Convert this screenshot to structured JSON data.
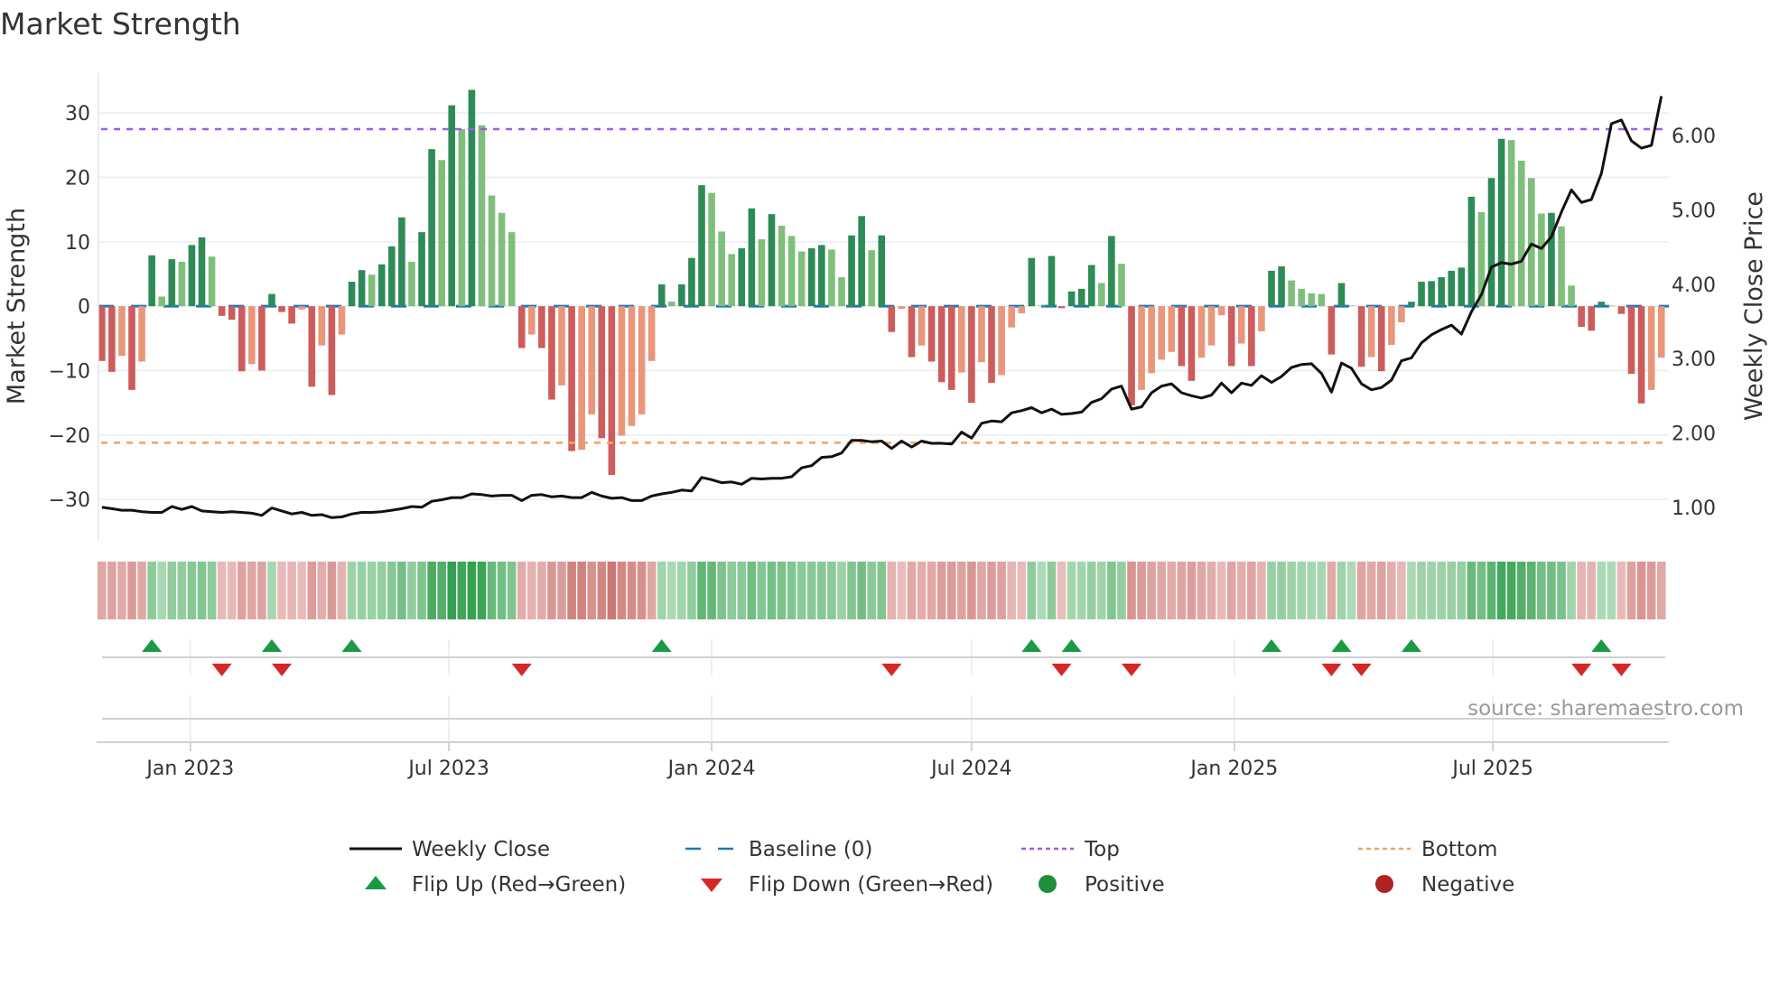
{
  "title": "Market Strength",
  "source": "source: sharemaestro.com",
  "colors": {
    "bar_pos_strong": "#2e8b57",
    "bar_pos_weak": "#7fbf7b",
    "bar_neg_strong": "#cd5c5c",
    "bar_neg_weak": "#e9967a",
    "baseline": "#1f77b4",
    "top": "#9b5de5",
    "bottom": "#f4a261",
    "close": "#111111",
    "flip_up": "#1a9a45",
    "flip_down": "#d62728",
    "positive": "#1e8f3a",
    "negative": "#b22222"
  },
  "legend": [
    {
      "key": "close",
      "label": "Weekly Close"
    },
    {
      "key": "baseline",
      "label": "Baseline (0)"
    },
    {
      "key": "top",
      "label": "Top"
    },
    {
      "key": "bottom",
      "label": "Bottom"
    },
    {
      "key": "flip_up",
      "label": "Flip Up (Red→Green)"
    },
    {
      "key": "flip_down",
      "label": "Flip Down (Green→Red)"
    },
    {
      "key": "positive",
      "label": "Positive"
    },
    {
      "key": "negative",
      "label": "Negative"
    }
  ],
  "chart_data": {
    "type": "bar",
    "x_start": "2022-10-31",
    "x_interval_days": 7,
    "strength": [
      -8.5,
      -10.2,
      -7.7,
      -13,
      -8.6,
      7.9,
      1.5,
      7.3,
      6.9,
      9.5,
      10.7,
      7.7,
      -1.5,
      -2.1,
      -10.1,
      -9,
      -10,
      1.9,
      -0.9,
      -2.7,
      -0.5,
      -12.5,
      -6.1,
      -13.8,
      -4.4,
      3.8,
      5.6,
      4.9,
      6.5,
      9.3,
      13.8,
      6.9,
      11.5,
      24.4,
      22.7,
      31.2,
      27.5,
      33.6,
      28.1,
      17.2,
      14.5,
      11.5,
      -6.5,
      -4.4,
      -6.5,
      -14.5,
      -12.3,
      -22.5,
      -22.3,
      -16.8,
      -20.5,
      -26.2,
      -20.1,
      -18.6,
      -16.8,
      -8.5,
      3.4,
      0.7,
      3.4,
      7.5,
      18.8,
      17.6,
      11.6,
      8.1,
      9,
      15.2,
      10.4,
      14.3,
      12.5,
      10.9,
      8.5,
      9,
      9.5,
      8.8,
      4.5,
      11,
      14,
      8.7,
      11,
      -4,
      -0.4,
      -7.9,
      -6.1,
      -8.6,
      -11.8,
      -13,
      -10.3,
      -15,
      -8.7,
      -11.9,
      -10.7,
      -3.3,
      -1.1,
      7.5,
      0.1,
      7.8,
      -0.3,
      2.3,
      2.7,
      6.4,
      3.6,
      10.9,
      6.6,
      -15.4,
      -13,
      -10.4,
      -8.3,
      -7.1,
      -9.3,
      -11.6,
      -8,
      -6.1,
      -1.4,
      -9.3,
      -5.8,
      -9.3,
      -3.9,
      5.5,
      6.2,
      4,
      2.7,
      2,
      1.9,
      -7.5,
      3.6,
      0.1,
      -9.4,
      -7.9,
      -10.1,
      -6,
      -2.5,
      0.7,
      3.8,
      3.9,
      4.5,
      5.5,
      6,
      17,
      14.6,
      19.9,
      26,
      25.8,
      22.6,
      19.9,
      14.4,
      14.5,
      12.4,
      3.2,
      -3.2,
      -3.8,
      0.7,
      0.1,
      -1.2,
      -10.5,
      -15.1,
      -13,
      -8
    ],
    "close": [
      1.0,
      0.98,
      0.96,
      0.96,
      0.94,
      0.93,
      0.93,
      1.01,
      0.97,
      1.01,
      0.95,
      0.94,
      0.93,
      0.94,
      0.93,
      0.92,
      0.89,
      0.99,
      0.95,
      0.91,
      0.93,
      0.89,
      0.9,
      0.86,
      0.87,
      0.91,
      0.93,
      0.93,
      0.94,
      0.96,
      0.98,
      1.01,
      1.0,
      1.08,
      1.1,
      1.13,
      1.13,
      1.18,
      1.17,
      1.15,
      1.16,
      1.16,
      1.09,
      1.16,
      1.17,
      1.14,
      1.15,
      1.13,
      1.13,
      1.2,
      1.15,
      1.12,
      1.13,
      1.09,
      1.09,
      1.15,
      1.18,
      1.2,
      1.23,
      1.22,
      1.4,
      1.37,
      1.33,
      1.34,
      1.31,
      1.39,
      1.38,
      1.39,
      1.39,
      1.41,
      1.53,
      1.56,
      1.67,
      1.68,
      1.73,
      1.9,
      1.9,
      1.88,
      1.89,
      1.79,
      1.89,
      1.81,
      1.89,
      1.86,
      1.86,
      1.85,
      2.01,
      1.93,
      2.13,
      2.16,
      2.15,
      2.27,
      2.3,
      2.34,
      2.27,
      2.32,
      2.25,
      2.26,
      2.28,
      2.41,
      2.46,
      2.59,
      2.63,
      2.32,
      2.35,
      2.54,
      2.63,
      2.66,
      2.54,
      2.5,
      2.47,
      2.51,
      2.67,
      2.54,
      2.67,
      2.64,
      2.77,
      2.68,
      2.76,
      2.88,
      2.92,
      2.93,
      2.8,
      2.55,
      2.94,
      2.87,
      2.66,
      2.58,
      2.61,
      2.71,
      2.97,
      3.01,
      3.21,
      3.32,
      3.39,
      3.45,
      3.33,
      3.63,
      3.86,
      4.23,
      4.29,
      4.27,
      4.31,
      4.54,
      4.48,
      4.64,
      4.97,
      5.27,
      5.1,
      5.14,
      5.49,
      6.16,
      6.21,
      5.93,
      5.83,
      5.87,
      6.53
    ],
    "top_line": 27.5,
    "bottom_line": -21.2,
    "baseline": 0,
    "left_axis": {
      "label": "Market Strength",
      "ylim": [
        -36.3,
        36.2
      ],
      "ticks": [
        30,
        20,
        10,
        0,
        -10,
        -20,
        -30
      ],
      "tick_labels": [
        "30",
        "20",
        "10",
        "0",
        "−10",
        "−20",
        "−30"
      ]
    },
    "right_axis": {
      "label": "Weekly Close Price",
      "ylim": [
        0.56,
        6.84
      ],
      "ticks": [
        6,
        5,
        4,
        3,
        2,
        1
      ],
      "tick_labels": [
        "6.00",
        "5.00",
        "4.00",
        "3.00",
        "2.00",
        "1.00"
      ]
    },
    "x_ticks": [
      {
        "date": "2023-01-01",
        "label": "Jan 2023"
      },
      {
        "date": "2023-07-01",
        "label": "Jul 2023"
      },
      {
        "date": "2024-01-01",
        "label": "Jan 2024"
      },
      {
        "date": "2024-07-01",
        "label": "Jul 2024"
      },
      {
        "date": "2025-01-01",
        "label": "Jan 2025"
      },
      {
        "date": "2025-07-01",
        "label": "Jul 2025"
      }
    ]
  }
}
